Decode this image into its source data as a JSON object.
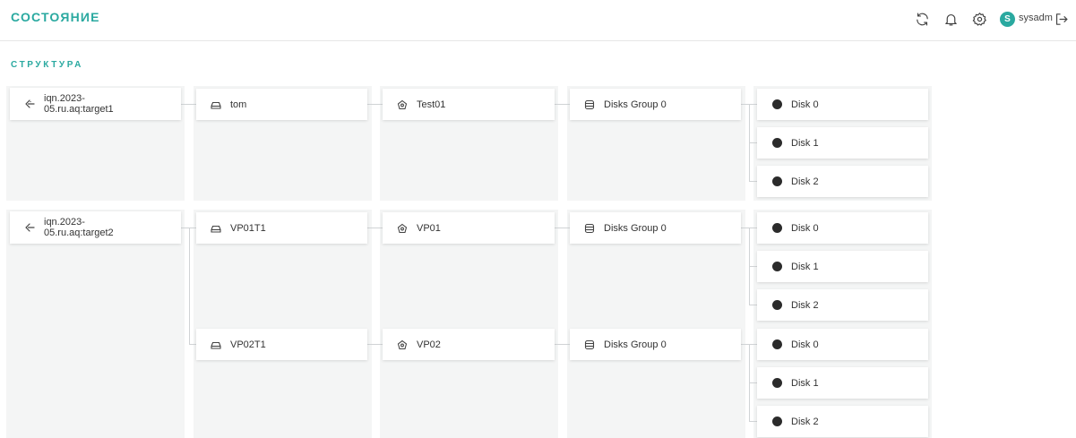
{
  "header": {
    "title": "СОСТОЯНИЕ",
    "icons": [
      "refresh-icon",
      "bell-icon",
      "gear-icon",
      "logout-icon"
    ],
    "user": {
      "initial": "S",
      "name": "sysadm"
    }
  },
  "section": {
    "title": "СТРУКТУРА"
  },
  "accent_color": "#2aa9a0",
  "tree": [
    {
      "target": "iqn.2023-\n05.ru.aq:target1",
      "volumes": [
        {
          "name": "tom",
          "pool": "Test01",
          "group": "Disks Group 0",
          "disks": [
            "Disk 0",
            "Disk 1",
            "Disk 2"
          ]
        }
      ]
    },
    {
      "target": "iqn.2023-\n05.ru.aq:target2",
      "volumes": [
        {
          "name": "VP01T1",
          "pool": "VP01",
          "group": "Disks Group 0",
          "disks": [
            "Disk 0",
            "Disk 1",
            "Disk 2"
          ]
        },
        {
          "name": "VP02T1",
          "pool": "VP02",
          "group": "Disks Group 0",
          "disks": [
            "Disk 0",
            "Disk 1",
            "Disk 2"
          ]
        }
      ]
    }
  ]
}
